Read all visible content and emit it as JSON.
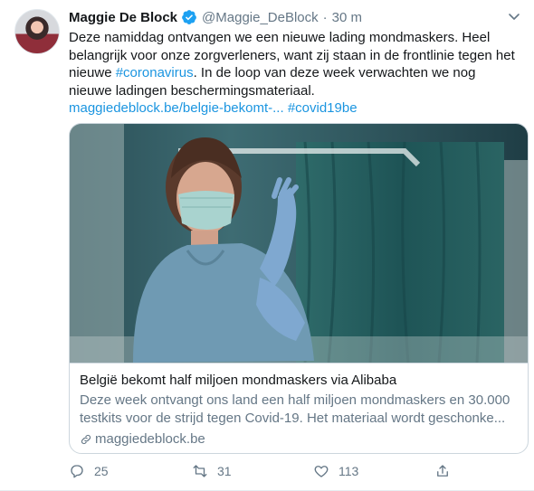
{
  "tweet": {
    "author_name": "Maggie De Block",
    "handle": "@Maggie_DeBlock",
    "separator": "·",
    "time": "30 m",
    "text_lines": [
      "Deze namiddag ontvangen we een nieuwe lading mondmaskers. Heel",
      "belangrijk voor onze zorgverleners, want zij staan in de frontlinie tegen het"
    ],
    "line3_prefix": "nieuwe ",
    "hashtag_coronavirus": "#coronavirus",
    "line3_suffix": ". In de loop van deze week verwachten we nog",
    "line4": "nieuwe ladingen beschermingsmateriaal.",
    "link_text": "maggiedeblock.be/belgie-bekomt-...",
    "hashtag_covid": "#covid19be"
  },
  "card": {
    "title": "België bekomt half miljoen mondmaskers via Alibaba",
    "desc_line1": "Deze week ontvangt ons land een half miljoen mondmaskers en 30.000",
    "desc_line2": "testkits voor de strijd tegen Covid-19. Het materiaal wordt geschonke...",
    "domain": "maggiedeblock.be"
  },
  "actions": {
    "replies": "25",
    "retweets": "31",
    "likes": "113"
  },
  "colors": {
    "link": "#1b95e0",
    "secondary_text": "#657786",
    "primary_text": "#14171a",
    "verified": "#1da1f2"
  },
  "icons": [
    "verified-badge-icon",
    "caret-down-icon",
    "link-icon",
    "reply-icon",
    "retweet-icon",
    "like-icon",
    "share-icon"
  ]
}
